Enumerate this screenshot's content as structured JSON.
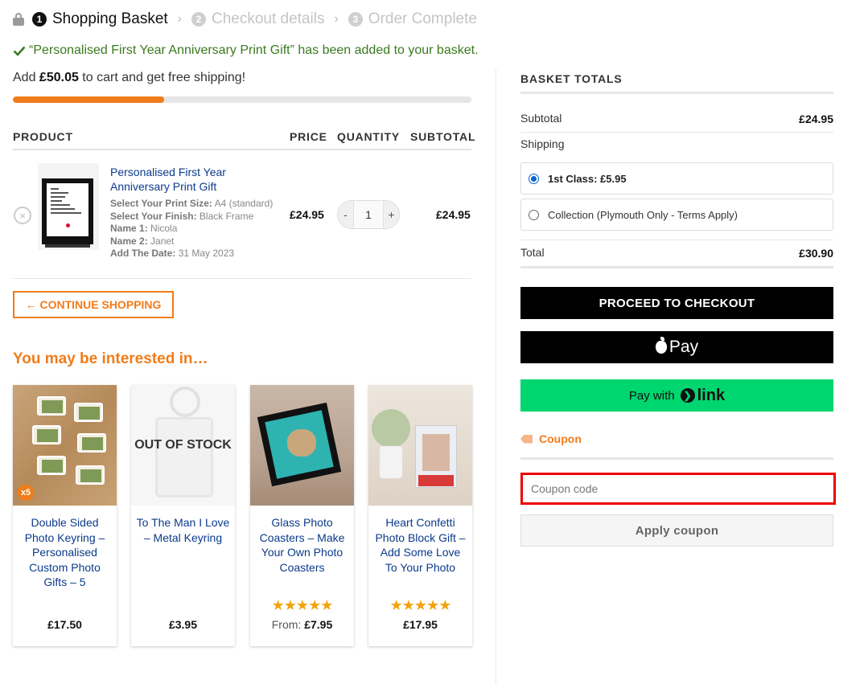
{
  "steps": [
    {
      "num": "1",
      "label": "Shopping Basket"
    },
    {
      "num": "2",
      "label": "Checkout details"
    },
    {
      "num": "3",
      "label": "Order Complete"
    }
  ],
  "notice": "“Personalised First Year Anniversary Print Gift” has been added to your basket.",
  "shipping": {
    "prefix": "Add ",
    "amount": "£50.05",
    "suffix": " to cart and get free shipping!",
    "progress_fraction": 0.33
  },
  "table": {
    "headers": {
      "product": "PRODUCT",
      "price": "PRICE",
      "quantity": "QUANTITY",
      "subtotal": "SUBTOTAL"
    },
    "item": {
      "name": "Personalised First Year Anniversary Print Gift",
      "meta": [
        {
          "k": "Select Your Print Size:",
          "v": "A4 (standard)"
        },
        {
          "k": "Select Your Finish:",
          "v": "Black Frame"
        },
        {
          "k": "Name 1:",
          "v": "Nicola"
        },
        {
          "k": "Name 2:",
          "v": "Janet"
        },
        {
          "k": "Add The Date:",
          "v": "31 May 2023"
        }
      ],
      "price": "£24.95",
      "quantity": "1",
      "minus": "-",
      "plus": "+",
      "subtotal": "£24.95",
      "remove_glyph": "×"
    }
  },
  "continue_label": "← CONTINUE SHOPPING",
  "interested_title": "You may be interested in…",
  "products": [
    {
      "title": "Double Sided Photo Keyring – Personalised Custom Photo Gifts – 5",
      "badge": "x5",
      "price": "£17.50",
      "from": "",
      "stars": ""
    },
    {
      "title": "To The Man I Love – Metal Keyring",
      "overlay": "OUT OF STOCK",
      "price": "£3.95",
      "from": "",
      "stars": ""
    },
    {
      "title": "Glass Photo Coasters – Make Your Own Photo Coasters",
      "price": "£7.95",
      "from": "From: ",
      "stars": "★★★★★",
      "rating": 5
    },
    {
      "title": "Heart Confetti Photo Block Gift – Add Some Love To Your Photo",
      "price": "£17.95",
      "from": "",
      "stars": "★★★★★",
      "rating": 5
    }
  ],
  "totals": {
    "title": "BASKET TOTALS",
    "subtotal_label": "Subtotal",
    "subtotal_value": "£24.95",
    "shipping_label": "Shipping",
    "options": [
      {
        "label": "1st Class:  £5.95",
        "selected": true
      },
      {
        "label": "Collection (Plymouth Only - Terms Apply)",
        "selected": false
      }
    ],
    "total_label": "Total",
    "total_value": "£30.90"
  },
  "buttons": {
    "checkout": "PROCEED TO CHECKOUT",
    "apple_pay": "Pay",
    "link_prefix": "Pay with",
    "link_circle": "❯",
    "link_word": "link"
  },
  "coupon": {
    "label": "Coupon",
    "placeholder": "Coupon code",
    "apply": "Apply coupon"
  },
  "colors": {
    "accent": "#f07c1a",
    "link_blue": "#0b3a8c",
    "notice_green": "#3a7a1f",
    "link_green": "#00d66f"
  }
}
